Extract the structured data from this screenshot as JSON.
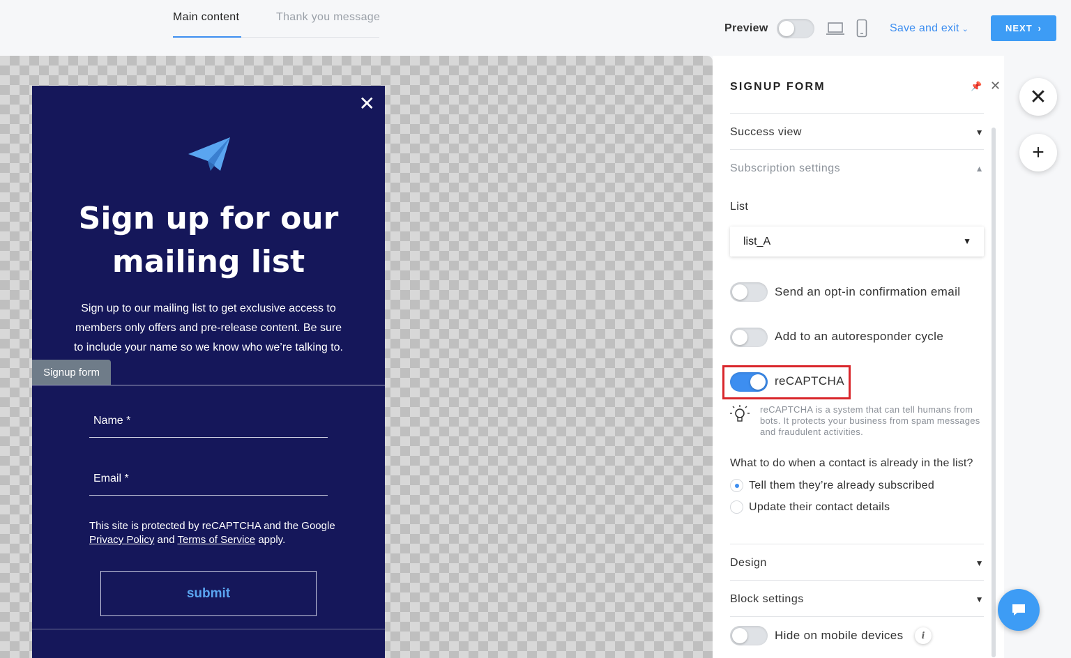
{
  "tabs": {
    "main": "Main content",
    "thanks": "Thank you message"
  },
  "toolbar": {
    "preview_label": "Preview",
    "save_exit": "Save and exit",
    "next": "NEXT"
  },
  "form": {
    "title_line1": "Sign up for our",
    "title_line2": "mailing list",
    "description": "Sign up to our mailing list to get exclusive access to members only offers and pre-release content. Be sure to include your name so we know who we’re talking to.",
    "tag": "Signup form",
    "name_field": "Name *",
    "email_field": "Email *",
    "recaptcha_note_prefix": "This site is protected by reCAPTCHA and the Google ",
    "privacy_link": "Privacy Policy",
    "and": " and ",
    "terms_link": "Terms of Service",
    "apply": " apply.",
    "submit": "submit"
  },
  "panel": {
    "title": "SIGNUP FORM",
    "success_view": "Success view",
    "subscription_settings": "Subscription settings",
    "list_label": "List",
    "list_value": "list_A",
    "opt_in": "Send an opt-in confirmation email",
    "autoresponder": "Add to an autoresponder cycle",
    "recaptcha": "reCAPTCHA",
    "recaptcha_help": "reCAPTCHA is a system that can tell humans from bots. It protects your business from spam messages and fraudulent activities.",
    "question": "What to do when a contact is already in the list?",
    "option1": "Tell them they’re already subscribed",
    "option2": "Update their contact details",
    "design": "Design",
    "block_settings": "Block settings",
    "hide_mobile": "Hide on mobile devices",
    "toggles": {
      "preview": false,
      "opt_in": false,
      "autoresponder": false,
      "recaptcha": true,
      "hide_mobile": false
    }
  },
  "colors": {
    "accent": "#3d8ef0",
    "form_bg": "#15175a",
    "highlight": "#d9262b"
  }
}
